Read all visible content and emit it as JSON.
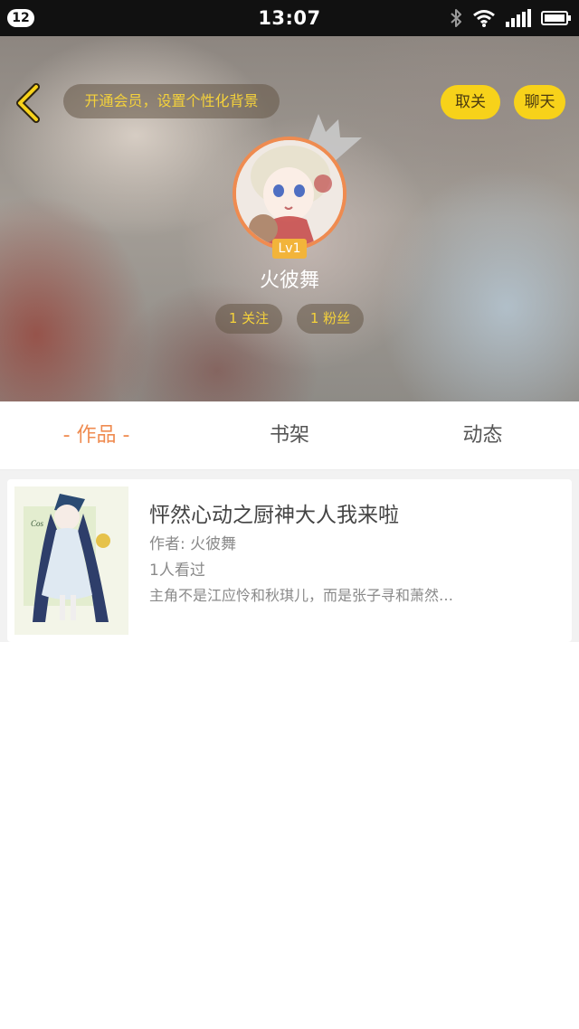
{
  "status_bar": {
    "badge": "12",
    "time": "13:07"
  },
  "header": {
    "vip_prompt": "开通会员，设置个性化背景",
    "unfollow_label": "取关",
    "chat_label": "聊天",
    "level": "Lv1",
    "username": "火彼舞",
    "following": "1 关注",
    "fans": "1 粉丝"
  },
  "tabs": [
    {
      "label": "- 作品 -",
      "active": true
    },
    {
      "label": "书架",
      "active": false
    },
    {
      "label": "动态",
      "active": false
    }
  ],
  "works": [
    {
      "title": "怦然心动之厨神大人我来啦",
      "author": "作者: 火彼舞",
      "views": "1人看过",
      "summary": "主角不是江应怜和秋琪儿，而是张子寻和萧然…"
    }
  ],
  "colors": {
    "accent_orange": "#ef8b50",
    "accent_yellow": "#f7d21a",
    "vip_text": "#f5d23b"
  },
  "icons": {
    "back": "chevron-left-icon",
    "bluetooth": "bluetooth-icon",
    "wifi": "wifi-icon",
    "signal": "signal-icon",
    "battery": "battery-icon",
    "crown": "crown-icon"
  }
}
